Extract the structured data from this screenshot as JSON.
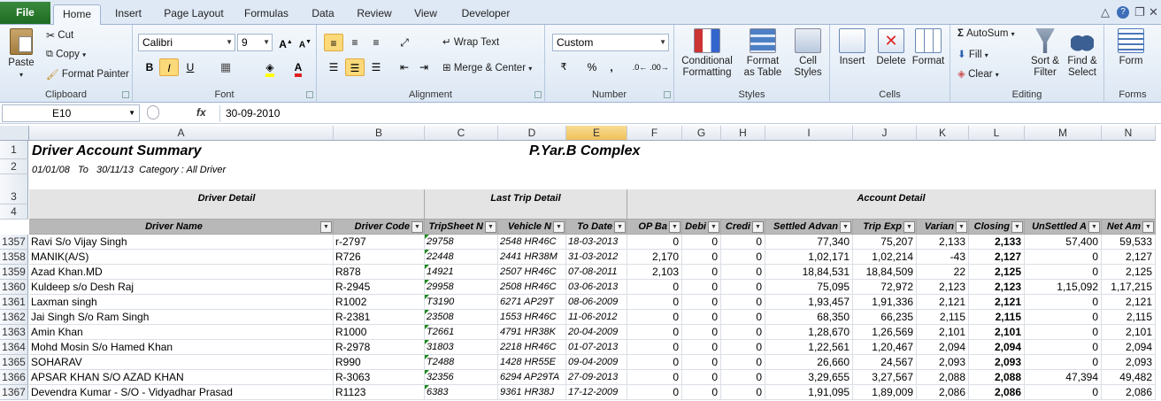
{
  "tabs": [
    "File",
    "Home",
    "Insert",
    "Page Layout",
    "Formulas",
    "Data",
    "Review",
    "View",
    "Developer"
  ],
  "ribbon": {
    "clipboard": {
      "paste": "Paste",
      "cut": "Cut",
      "copy": "Copy",
      "format_painter": "Format Painter",
      "label": "Clipboard"
    },
    "font": {
      "name": "Calibri",
      "size": "9",
      "label": "Font"
    },
    "alignment": {
      "wrap": "Wrap Text",
      "merge": "Merge & Center",
      "label": "Alignment"
    },
    "number": {
      "format": "Custom",
      "label": "Number"
    },
    "styles": {
      "conditional": "Conditional\nFormatting",
      "format_table": "Format\nas Table",
      "cell_styles": "Cell\nStyles",
      "label": "Styles"
    },
    "cells": {
      "insert": "Insert",
      "delete": "Delete",
      "format": "Format",
      "label": "Cells"
    },
    "editing": {
      "autosum": "AutoSum",
      "fill": "Fill",
      "clear": "Clear",
      "sort": "Sort &\nFilter",
      "find": "Find &\nSelect",
      "label": "Editing"
    },
    "forms": {
      "form": "Form",
      "label": "Forms"
    }
  },
  "formula_bar": {
    "name_box": "E10",
    "fx": "fx",
    "value": "30-09-2010"
  },
  "columns": [
    "A",
    "B",
    "C",
    "D",
    "E",
    "F",
    "G",
    "H",
    "I",
    "J",
    "K",
    "L",
    "M",
    "N"
  ],
  "sheet": {
    "title": "Driver Account Summary",
    "company": "P.Yar.B Complex",
    "subtitle": "01/01/08   To   30/11/13  Category : All Driver",
    "group_driver": "Driver Detail",
    "group_trip": "Last Trip Detail",
    "group_account": "Account Detail",
    "headers": [
      "Driver Name",
      "Driver Code",
      "TripSheet N",
      "Vehicle N",
      "To Date",
      "OP Ba",
      "Debi",
      "Credi",
      "Settled Advan",
      "Trip Exp",
      "Varian",
      "Closing",
      "UnSettled A",
      "Net Am"
    ],
    "header_rows": [
      "1",
      "2",
      "3",
      "4"
    ],
    "rows": [
      {
        "n": "1357",
        "name": "Ravi S/o Vijay Singh",
        "code": "r-2797",
        "trip": "29758",
        "veh": "2548 HR46C",
        "date": "18-03-2013",
        "op": "0",
        "deb": "0",
        "cre": "0",
        "sett": "77,340",
        "exp": "75,207",
        "var": "2,133",
        "clo": "2,133",
        "uns": "57,400",
        "net": "59,533"
      },
      {
        "n": "1358",
        "name": "MANIK(A/S)",
        "code": "R726",
        "trip": "22448",
        "veh": "2441 HR38M",
        "date": "31-03-2012",
        "op": "2,170",
        "deb": "0",
        "cre": "0",
        "sett": "1,02,171",
        "exp": "1,02,214",
        "var": "-43",
        "clo": "2,127",
        "uns": "0",
        "net": "2,127"
      },
      {
        "n": "1359",
        "name": "Azad Khan.MD",
        "code": "R878",
        "trip": "14921",
        "veh": "2507 HR46C",
        "date": "07-08-2011",
        "op": "2,103",
        "deb": "0",
        "cre": "0",
        "sett": "18,84,531",
        "exp": "18,84,509",
        "var": "22",
        "clo": "2,125",
        "uns": "0",
        "net": "2,125"
      },
      {
        "n": "1360",
        "name": "Kuldeep s/o Desh Raj",
        "code": "R-2945",
        "trip": "29958",
        "veh": "2508 HR46C",
        "date": "03-06-2013",
        "op": "0",
        "deb": "0",
        "cre": "0",
        "sett": "75,095",
        "exp": "72,972",
        "var": "2,123",
        "clo": "2,123",
        "uns": "1,15,092",
        "net": "1,17,215"
      },
      {
        "n": "1361",
        "name": "Laxman singh",
        "code": "R1002",
        "trip": "T3190",
        "veh": "6271 AP29T",
        "date": "08-06-2009",
        "op": "0",
        "deb": "0",
        "cre": "0",
        "sett": "1,93,457",
        "exp": "1,91,336",
        "var": "2,121",
        "clo": "2,121",
        "uns": "0",
        "net": "2,121"
      },
      {
        "n": "1362",
        "name": "Jai Singh S/o Ram Singh",
        "code": "R-2381",
        "trip": "23508",
        "veh": "1553 HR46C",
        "date": "11-06-2012",
        "op": "0",
        "deb": "0",
        "cre": "0",
        "sett": "68,350",
        "exp": "66,235",
        "var": "2,115",
        "clo": "2,115",
        "uns": "0",
        "net": "2,115"
      },
      {
        "n": "1363",
        "name": "Amin Khan",
        "code": "R1000",
        "trip": "T2661",
        "veh": "4791 HR38K",
        "date": "20-04-2009",
        "op": "0",
        "deb": "0",
        "cre": "0",
        "sett": "1,28,670",
        "exp": "1,26,569",
        "var": "2,101",
        "clo": "2,101",
        "uns": "0",
        "net": "2,101"
      },
      {
        "n": "1364",
        "name": "Mohd Mosin S/o Hamed Khan",
        "code": "R-2978",
        "trip": "31803",
        "veh": "2218 HR46C",
        "date": "01-07-2013",
        "op": "0",
        "deb": "0",
        "cre": "0",
        "sett": "1,22,561",
        "exp": "1,20,467",
        "var": "2,094",
        "clo": "2,094",
        "uns": "0",
        "net": "2,094"
      },
      {
        "n": "1365",
        "name": "SOHARAV",
        "code": "R990",
        "trip": "T2488",
        "veh": "1428 HR55E",
        "date": "09-04-2009",
        "op": "0",
        "deb": "0",
        "cre": "0",
        "sett": "26,660",
        "exp": "24,567",
        "var": "2,093",
        "clo": "2,093",
        "uns": "0",
        "net": "2,093"
      },
      {
        "n": "1366",
        "name": "APSAR KHAN S/O AZAD KHAN",
        "code": "R-3063",
        "trip": "32356",
        "veh": "6294 AP29TA",
        "date": "27-09-2013",
        "op": "0",
        "deb": "0",
        "cre": "0",
        "sett": "3,29,655",
        "exp": "3,27,567",
        "var": "2,088",
        "clo": "2,088",
        "uns": "47,394",
        "net": "49,482"
      },
      {
        "n": "1367",
        "name": "Devendra Kumar - S/O - Vidyadhar Prasad",
        "code": "R1123",
        "trip": "6383",
        "veh": "9361 HR38J",
        "date": "17-12-2009",
        "op": "0",
        "deb": "0",
        "cre": "0",
        "sett": "1,91,095",
        "exp": "1,89,009",
        "var": "2,086",
        "clo": "2,086",
        "uns": "0",
        "net": "2,086"
      }
    ]
  }
}
